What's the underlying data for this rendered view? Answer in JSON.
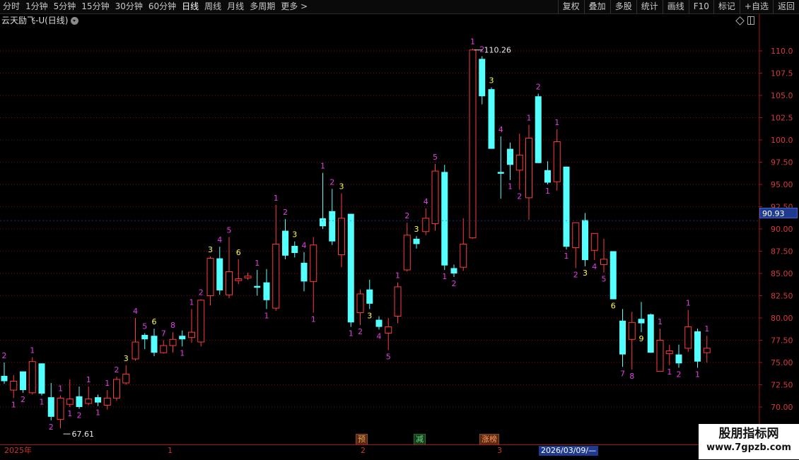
{
  "toolbar": {
    "periods": [
      "分时",
      "1分钟",
      "5分钟",
      "15分钟",
      "30分钟",
      "60分钟",
      "日线",
      "周线",
      "月线",
      "多周期",
      "更多 >"
    ],
    "active_period": "日线",
    "right_items": [
      "复权",
      "叠加",
      "多股",
      "统计",
      "画线",
      "F10",
      "标记",
      "+自选",
      "返回"
    ]
  },
  "header": {
    "title": "云天励飞-U(日线)"
  },
  "colors": {
    "up": "#ff3b3b",
    "down": "#54ffff",
    "grid": "#7a1010",
    "axis": "#a01818",
    "label_magenta": "#e040e0",
    "label_yellow": "#ffff40"
  },
  "current_price": "90.93",
  "markers": {
    "pre": "预",
    "sub": "减",
    "zt": "涨榜"
  },
  "bottom": {
    "year_label": "2025年",
    "m1": "1",
    "m2": "2",
    "m3": "3",
    "date_sel": "2026/03/09/—"
  },
  "watermark": {
    "title": "股朋指标网",
    "url": "www.7gpzb.com"
  },
  "chart_data": {
    "type": "candlestick",
    "y_ticks": [
      "110.0",
      "107.5",
      "105.0",
      "102.5",
      "100.0",
      "97.50",
      "95.00",
      "92.50",
      "90.00",
      "87.50",
      "85.00",
      "82.50",
      "80.00",
      "77.50",
      "75.00",
      "72.50",
      "70.00"
    ],
    "ylim": [
      68.3,
      114.3
    ],
    "annotations": {
      "high": "110.26",
      "low": "67.61"
    },
    "candles": [
      {
        "o": 73.5,
        "h": 75.0,
        "l": 72.6,
        "c": 72.9,
        "t": "2",
        "tc": "m",
        "tp": "a"
      },
      {
        "o": 71.9,
        "h": 73.6,
        "l": 71.0,
        "c": 72.9,
        "t": "1",
        "tc": "m",
        "tp": "b"
      },
      {
        "o": 74.0,
        "h": 74.0,
        "l": 71.6,
        "c": 71.9,
        "t": "2",
        "tc": "m",
        "tp": "b"
      },
      {
        "o": 71.6,
        "h": 75.6,
        "l": 71.4,
        "c": 75.1,
        "t": "1",
        "tc": "m",
        "tp": "a"
      },
      {
        "o": 74.9,
        "h": 74.9,
        "l": 71.3,
        "c": 71.5,
        "t": "1",
        "tc": "m",
        "tp": "b"
      },
      {
        "o": 71.1,
        "h": 72.7,
        "l": 68.5,
        "c": 68.9,
        "t": "2",
        "tc": "m",
        "tp": "b"
      },
      {
        "o": 68.6,
        "h": 71.3,
        "l": 67.61,
        "c": 71.0,
        "t": "1",
        "tc": "m",
        "tp": "a"
      },
      {
        "o": 70.3,
        "h": 73.1,
        "l": 70.0,
        "c": 70.9,
        "t": "1",
        "tc": "m",
        "tp": "b"
      },
      {
        "o": 71.2,
        "h": 72.3,
        "l": 69.8,
        "c": 70.0,
        "t": "2",
        "tc": "m",
        "tp": "b"
      },
      {
        "o": 70.4,
        "h": 72.3,
        "l": 70.2,
        "c": 70.9,
        "t": "1",
        "tc": "m",
        "tp": "a"
      },
      {
        "o": 71.1,
        "h": 71.4,
        "l": 70.1,
        "c": 70.5,
        "t": "1",
        "tc": "m",
        "tp": "b"
      },
      {
        "o": 70.2,
        "h": 71.9,
        "l": 69.7,
        "c": 71.0,
        "t": "1",
        "tc": "m",
        "tp": "a"
      },
      {
        "o": 71.0,
        "h": 73.4,
        "l": 70.7,
        "c": 73.1,
        "t": "2",
        "tc": "m",
        "tp": "a"
      },
      {
        "o": 72.7,
        "h": 74.7,
        "l": 72.5,
        "c": 73.7,
        "t": "3",
        "tc": "y",
        "tp": "a"
      },
      {
        "o": 75.4,
        "h": 80.0,
        "l": 75.2,
        "c": 77.3,
        "t": "4",
        "tc": "m",
        "tp": "a"
      },
      {
        "o": 78.1,
        "h": 78.3,
        "l": 76.5,
        "c": 77.6,
        "t": "5",
        "tc": "m",
        "tp": "a"
      },
      {
        "o": 78.0,
        "h": 78.8,
        "l": 75.7,
        "c": 76.1,
        "t": "6",
        "tc": "y",
        "tp": "a"
      },
      {
        "o": 76.1,
        "h": 77.5,
        "l": 76.0,
        "c": 76.9,
        "t": "7",
        "tc": "m",
        "tp": "a"
      },
      {
        "o": 76.9,
        "h": 78.4,
        "l": 76.1,
        "c": 77.6,
        "t": "8",
        "tc": "m",
        "tp": "a"
      },
      {
        "o": 78.0,
        "h": 78.6,
        "l": 76.8,
        "c": 77.6,
        "t": "1",
        "tc": "m",
        "tp": "b"
      },
      {
        "o": 77.8,
        "h": 81.0,
        "l": 77.2,
        "c": 78.4,
        "t": "1",
        "tc": "m",
        "tp": "a"
      },
      {
        "o": 77.3,
        "h": 82.1,
        "l": 76.8,
        "c": 82.0,
        "t": "2",
        "tc": "m",
        "tp": "a"
      },
      {
        "o": 82.5,
        "h": 86.9,
        "l": 81.4,
        "c": 86.7,
        "t": "3",
        "tc": "y",
        "tp": "a"
      },
      {
        "o": 86.7,
        "h": 88.0,
        "l": 82.6,
        "c": 83.1,
        "t": "4",
        "tc": "m",
        "tp": "a"
      },
      {
        "o": 82.6,
        "h": 89.1,
        "l": 82.2,
        "c": 85.2,
        "t": "5",
        "tc": "m",
        "tp": "a"
      },
      {
        "o": 84.2,
        "h": 86.6,
        "l": 83.8,
        "c": 84.4,
        "t": "6",
        "tc": "y",
        "tp": "a"
      },
      {
        "o": 84.5,
        "h": 85.1,
        "l": 84.3,
        "c": 84.7,
        "t": "",
        "tc": "m",
        "tp": "a"
      },
      {
        "o": 83.6,
        "h": 85.4,
        "l": 82.5,
        "c": 83.4,
        "t": "1",
        "tc": "m",
        "tp": "a"
      },
      {
        "o": 84.0,
        "h": 85.5,
        "l": 81.0,
        "c": 82.0,
        "t": "1",
        "tc": "m",
        "tp": "b"
      },
      {
        "o": 81.1,
        "h": 92.7,
        "l": 80.8,
        "c": 88.3,
        "t": "1",
        "tc": "m",
        "tp": "a"
      },
      {
        "o": 89.8,
        "h": 91.1,
        "l": 86.6,
        "c": 87.0,
        "t": "2",
        "tc": "m",
        "tp": "a"
      },
      {
        "o": 88.1,
        "h": 88.6,
        "l": 86.8,
        "c": 87.3,
        "t": "3",
        "tc": "y",
        "tp": "a"
      },
      {
        "o": 86.2,
        "h": 87.4,
        "l": 83.0,
        "c": 84.1,
        "t": "4",
        "tc": "m",
        "tp": "a"
      },
      {
        "o": 84.1,
        "h": 89.1,
        "l": 80.6,
        "c": 88.2,
        "t": "1",
        "tc": "m",
        "tp": "b"
      },
      {
        "o": 91.2,
        "h": 96.3,
        "l": 90.0,
        "c": 90.3,
        "t": "1",
        "tc": "m",
        "tp": "a"
      },
      {
        "o": 92.0,
        "h": 94.5,
        "l": 88.2,
        "c": 88.6,
        "t": "2",
        "tc": "m",
        "tp": "a"
      },
      {
        "o": 87.1,
        "h": 94.0,
        "l": 85.7,
        "c": 91.2,
        "t": "3",
        "tc": "y",
        "tp": "a"
      },
      {
        "o": 91.7,
        "h": 91.7,
        "l": 79.0,
        "c": 79.5,
        "t": "1",
        "tc": "m",
        "tp": "b"
      },
      {
        "o": 80.6,
        "h": 83.2,
        "l": 79.2,
        "c": 82.7,
        "t": "2",
        "tc": "m",
        "tp": "b"
      },
      {
        "o": 83.2,
        "h": 84.3,
        "l": 81.0,
        "c": 81.6,
        "t": "3",
        "tc": "y",
        "tp": "b"
      },
      {
        "o": 79.8,
        "h": 80.2,
        "l": 78.7,
        "c": 79.0,
        "t": "4",
        "tc": "m",
        "tp": "b"
      },
      {
        "o": 78.3,
        "h": 80.0,
        "l": 76.4,
        "c": 79.0,
        "t": "5",
        "tc": "m",
        "tp": "b"
      },
      {
        "o": 80.2,
        "h": 84.0,
        "l": 79.4,
        "c": 83.5,
        "t": "1",
        "tc": "m",
        "tp": "a"
      },
      {
        "o": 85.4,
        "h": 90.7,
        "l": 85.2,
        "c": 89.3,
        "t": "2",
        "tc": "m",
        "tp": "a"
      },
      {
        "o": 88.9,
        "h": 89.2,
        "l": 87.8,
        "c": 88.3,
        "t": "3",
        "tc": "y",
        "tp": "a"
      },
      {
        "o": 89.7,
        "h": 92.3,
        "l": 89.3,
        "c": 91.2,
        "t": "4",
        "tc": "m",
        "tp": "a"
      },
      {
        "o": 90.6,
        "h": 97.3,
        "l": 89.8,
        "c": 96.5,
        "t": "5",
        "tc": "m",
        "tp": "a"
      },
      {
        "o": 96.4,
        "h": 97.2,
        "l": 85.4,
        "c": 85.9,
        "t": "1",
        "tc": "m",
        "tp": "b"
      },
      {
        "o": 85.6,
        "h": 86.0,
        "l": 84.6,
        "c": 85.0,
        "t": "2",
        "tc": "m",
        "tp": "b"
      },
      {
        "o": 85.7,
        "h": 91.2,
        "l": 85.3,
        "c": 88.3,
        "t": "",
        "tc": "m",
        "tp": "a"
      },
      {
        "o": 89.0,
        "h": 110.26,
        "l": 88.9,
        "c": 110.1,
        "t": "1",
        "tc": "m",
        "tp": "a"
      },
      {
        "o": 109.1,
        "h": 109.4,
        "l": 104.0,
        "c": 104.9,
        "t": "2",
        "tc": "m",
        "tp": "a"
      },
      {
        "o": 105.7,
        "h": 105.9,
        "l": 99.5,
        "c": 99.0,
        "t": "3",
        "tc": "y",
        "tp": "a"
      },
      {
        "o": 96.4,
        "h": 100.4,
        "l": 93.4,
        "c": 96.2,
        "t": "4",
        "tc": "m",
        "tp": "a"
      },
      {
        "o": 99.0,
        "h": 99.7,
        "l": 95.5,
        "c": 97.2,
        "t": "1",
        "tc": "m",
        "tp": "b"
      },
      {
        "o": 96.6,
        "h": 100.7,
        "l": 94.4,
        "c": 98.3,
        "t": "2",
        "tc": "m",
        "tp": "b"
      },
      {
        "o": 93.5,
        "h": 101.7,
        "l": 91.0,
        "c": 100.2,
        "t": "1",
        "tc": "m",
        "tp": "a"
      },
      {
        "o": 104.9,
        "h": 105.2,
        "l": 97.4,
        "c": 97.4,
        "t": "2",
        "tc": "m",
        "tp": "a"
      },
      {
        "o": 96.6,
        "h": 97.6,
        "l": 95.0,
        "c": 95.2,
        "t": "1",
        "tc": "m",
        "tp": "b"
      },
      {
        "o": 95.3,
        "h": 101.2,
        "l": 94.3,
        "c": 99.8,
        "t": "1",
        "tc": "m",
        "tp": "a"
      },
      {
        "o": 97.0,
        "h": 97.0,
        "l": 87.7,
        "c": 88.0,
        "t": "1",
        "tc": "m",
        "tp": "b"
      },
      {
        "o": 87.9,
        "h": 90.0,
        "l": 85.6,
        "c": 90.7,
        "t": "2",
        "tc": "m",
        "tp": "b"
      },
      {
        "o": 91.0,
        "h": 91.8,
        "l": 85.8,
        "c": 86.5,
        "t": "3",
        "tc": "y",
        "tp": "b"
      },
      {
        "o": 87.6,
        "h": 89.5,
        "l": 86.5,
        "c": 89.5,
        "t": "4",
        "tc": "m",
        "tp": "b"
      },
      {
        "o": 86.0,
        "h": 88.9,
        "l": 85.1,
        "c": 86.6,
        "t": "5",
        "tc": "m",
        "tp": "b"
      },
      {
        "o": 87.5,
        "h": 87.5,
        "l": 82.1,
        "c": 82.1,
        "t": "6",
        "tc": "y",
        "tp": "b"
      },
      {
        "o": 79.7,
        "h": 81.0,
        "l": 74.5,
        "c": 75.9,
        "t": "7",
        "tc": "m",
        "tp": "b"
      },
      {
        "o": 77.6,
        "h": 80.7,
        "l": 74.2,
        "c": 79.5,
        "t": "8",
        "tc": "m",
        "tp": "b"
      },
      {
        "o": 79.9,
        "h": 81.8,
        "l": 78.4,
        "c": 79.4,
        "t": "9",
        "tc": "y",
        "tp": "b"
      },
      {
        "o": 80.4,
        "h": 80.5,
        "l": 76.1,
        "c": 76.1,
        "t": "",
        "tc": "m",
        "tp": "a"
      },
      {
        "o": 74.0,
        "h": 78.8,
        "l": 74.1,
        "c": 77.5,
        "t": "1",
        "tc": "m",
        "tp": "a"
      },
      {
        "o": 76.0,
        "h": 77.0,
        "l": 74.7,
        "c": 76.3,
        "t": "1",
        "tc": "m",
        "tp": "b"
      },
      {
        "o": 75.9,
        "h": 77.0,
        "l": 74.4,
        "c": 74.9,
        "t": "2",
        "tc": "m",
        "tp": "b"
      },
      {
        "o": 76.6,
        "h": 80.9,
        "l": 76.2,
        "c": 79.0,
        "t": "1",
        "tc": "m",
        "tp": "a"
      },
      {
        "o": 78.5,
        "h": 78.8,
        "l": 74.4,
        "c": 75.1,
        "t": "1",
        "tc": "m",
        "tp": "b"
      },
      {
        "o": 76.1,
        "h": 78.0,
        "l": 75.0,
        "c": 76.6,
        "t": "1",
        "tc": "m",
        "tp": "a"
      }
    ]
  }
}
